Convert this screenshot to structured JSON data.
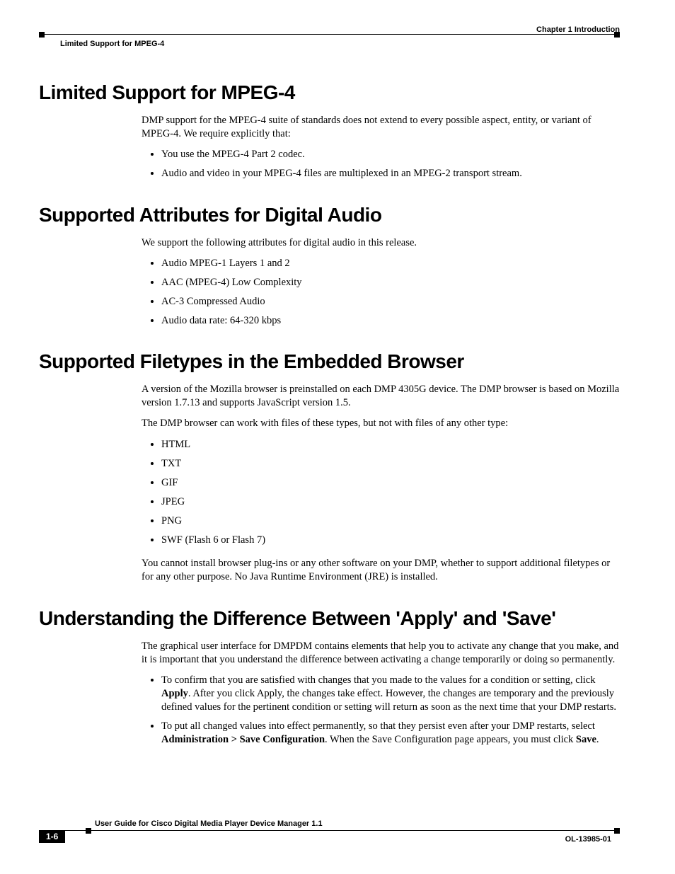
{
  "header": {
    "chapter_label": "Chapter 1      Introduction",
    "breadcrumb": "Limited Support for MPEG-4"
  },
  "sections": [
    {
      "heading": "Limited Support for MPEG-4",
      "intro": "DMP support for the MPEG-4 suite of standards does not extend to every possible aspect, entity, or variant of MPEG-4. We require explicitly that:",
      "bullets": [
        "You use the MPEG-4 Part 2 codec.",
        "Audio and video in your MPEG-4 files are multiplexed in an MPEG-2 transport stream."
      ]
    },
    {
      "heading": "Supported Attributes for Digital Audio",
      "intro": "We support the following attributes for digital audio in this release.",
      "bullets": [
        "Audio MPEG-1 Layers 1 and 2",
        "AAC (MPEG-4) Low Complexity",
        "AC-3 Compressed Audio",
        "Audio data rate: 64-320 kbps"
      ]
    },
    {
      "heading": "Supported Filetypes in the Embedded Browser",
      "intro": "A version of the Mozilla browser is preinstalled on each DMP 4305G device. The DMP browser is based on Mozilla version 1.7.13 and supports JavaScript version 1.5.",
      "intro2": "The DMP browser can work with files of these types, but not with files of any other type:",
      "bullets": [
        "HTML",
        "TXT",
        "GIF",
        "JPEG",
        "PNG",
        "SWF (Flash 6 or Flash 7)"
      ],
      "outro": "You cannot install browser plug-ins or any other software on your DMP, whether to support additional filetypes or for any other purpose. No Java Runtime Environment (JRE) is installed."
    },
    {
      "heading": "Understanding the Difference Between 'Apply' and 'Save'",
      "intro": "The graphical user interface for DMPDM contains elements that help you to activate any change that you make, and it is important that you understand the difference between activating a change temporarily or doing so permanently.",
      "rich_bullets": [
        {
          "pre": "To confirm that you are satisfied with changes that you made to the values for a condition or setting, click ",
          "b1": "Apply",
          "post": ". After you click Apply, the changes take effect. However, the changes are temporary and the previously defined values for the pertinent condition or setting will return as soon as the next time that your DMP restarts."
        },
        {
          "pre": "To put all changed values into effect permanently, so that they persist even after your DMP restarts, select ",
          "b1": "Administration > Save Configuration",
          "mid": ". When the Save Configuration page appears, you must click ",
          "b2": "Save",
          "post": "."
        }
      ]
    }
  ],
  "footer": {
    "guide_title": "User Guide for Cisco Digital Media Player Device Manager 1.1",
    "page_number": "1-6",
    "doc_id": "OL-13985-01"
  }
}
